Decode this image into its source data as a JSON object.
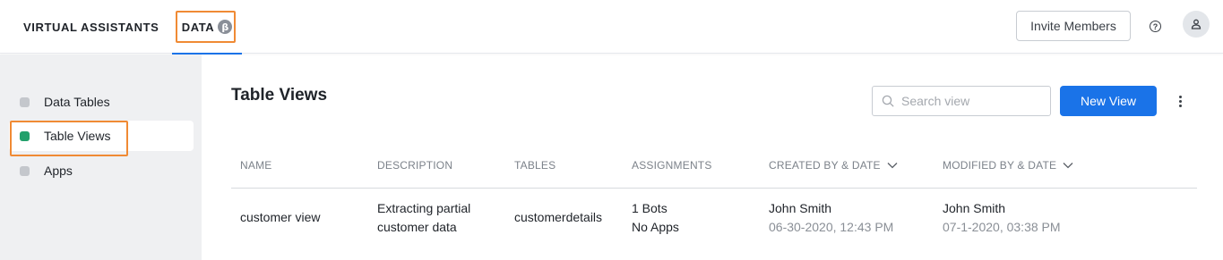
{
  "topnav": {
    "items": [
      {
        "label": "VIRTUAL ASSISTANTS"
      },
      {
        "label": "DATA",
        "badge": "β",
        "active": true
      }
    ],
    "invite_label": "Invite Members",
    "help_icon": "help-circle-icon",
    "avatar_icon": "user-icon",
    "accent_color": "#1a73e8"
  },
  "sidebar": {
    "items": [
      {
        "label": "Data Tables",
        "active": false
      },
      {
        "label": "Table Views",
        "active": true
      },
      {
        "label": "Apps",
        "active": false
      }
    ],
    "active_color": "#22a06b"
  },
  "main": {
    "title": "Table Views",
    "search": {
      "placeholder": "Search view",
      "value": ""
    },
    "new_view_label": "New View",
    "table": {
      "columns": [
        "NAME",
        "DESCRIPTION",
        "TABLES",
        "ASSIGNMENTS",
        "CREATED BY & DATE",
        "MODIFIED BY & DATE"
      ],
      "rows": [
        {
          "name": "customer view",
          "description_line1": "Extracting partial",
          "description_line2": "customer data",
          "tables": "customerdetails",
          "assignments_line1": "1 Bots",
          "assignments_line2": "No Apps",
          "created_by": "John Smith",
          "created_date": "06-30-2020, 12:43 PM",
          "modified_by": "John Smith",
          "modified_date": "07-1-2020, 03:38 PM"
        }
      ]
    }
  },
  "highlight_color": "#f08a34"
}
